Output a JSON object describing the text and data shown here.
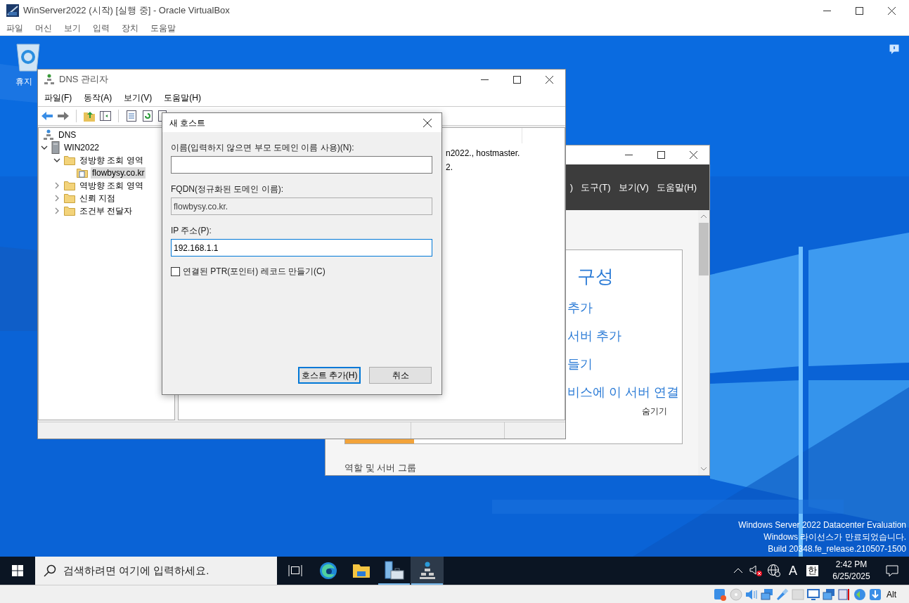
{
  "vbox": {
    "title": "WinServer2022 (시작) [실행 중] - Oracle VirtualBox",
    "menu": [
      "파일",
      "머신",
      "보기",
      "입력",
      "장치",
      "도움말"
    ],
    "host_key": "Alt"
  },
  "desktop": {
    "icons": [
      {
        "label": "휴지"
      }
    ],
    "watermark": [
      "Windows Server 2022 Datacenter Evaluation",
      "Windows 라이선스가 만료되었습니다.",
      "Build 20348.fe_release.210507-1500"
    ]
  },
  "server_manager": {
    "menu": [
      ")",
      "도구(T)",
      "보기(V)",
      "도움말(H)"
    ],
    "heading": "구성",
    "links": [
      "추가",
      "서버 추가",
      "들기",
      "비스에 이 서버 연결"
    ],
    "hide_link": "숨기기",
    "section": "역할 및 서버 그룹"
  },
  "dns_manager": {
    "title": "DNS 관리자",
    "menu": [
      "파일(F)",
      "동작(A)",
      "보기(V)",
      "도움말(H)"
    ],
    "tree": [
      {
        "label": "DNS",
        "kind": "root",
        "selected": false,
        "children": [
          {
            "label": "WIN2022",
            "kind": "server",
            "selected": false,
            "expanded": true,
            "children": [
              {
                "label": "정방향 조회 영역",
                "kind": "folder",
                "selected": false,
                "expanded": true,
                "children": [
                  {
                    "label": "flowbysy.co.kr",
                    "kind": "zone",
                    "selected": true
                  }
                ]
              },
              {
                "label": "역방향 조회 영역",
                "kind": "folder",
                "selected": false,
                "expanded": false
              },
              {
                "label": "신뢰 지점",
                "kind": "folder",
                "selected": false,
                "expanded": false
              },
              {
                "label": "조건부 전달자",
                "kind": "folder",
                "selected": false,
                "expanded": false
              }
            ]
          }
        ]
      }
    ],
    "details": [
      "n2022., hostmaster.",
      "2."
    ]
  },
  "dialog": {
    "title": "새 호스트",
    "fields": [
      {
        "label": "이름(입력하지 않으면 부모 도메인 이름 사용)(N):",
        "disabled": false,
        "focused": false
      },
      {
        "label": "FQDN(정규화된 도메인 이름):",
        "value": "flowbysy.co.kr.",
        "disabled": true,
        "focused": false
      },
      {
        "label": "IP 주소(P):",
        "value": "192.168.1.1",
        "disabled": false,
        "focused": true
      }
    ],
    "checkbox": {
      "label": "연결된 PTR(포인터) 레코드 만들기(C)",
      "checked": false
    },
    "buttons": [
      {
        "label": "호스트 추가(H)",
        "default": true
      },
      {
        "label": "취소",
        "default": false
      }
    ]
  },
  "taskbar": {
    "search_placeholder": "검색하려면 여기에 입력하세요.",
    "apps": [
      {
        "kind": "task-view",
        "running": false,
        "active": false
      },
      {
        "kind": "browser",
        "running": false,
        "active": false
      },
      {
        "kind": "explorer",
        "running": false,
        "active": false
      },
      {
        "kind": "server-manager",
        "running": true,
        "active": false
      },
      {
        "kind": "dns",
        "running": true,
        "active": true
      }
    ],
    "input_mode": "A",
    "ime": "한",
    "time": "2:42 PM",
    "date": "6/25/2025"
  }
}
